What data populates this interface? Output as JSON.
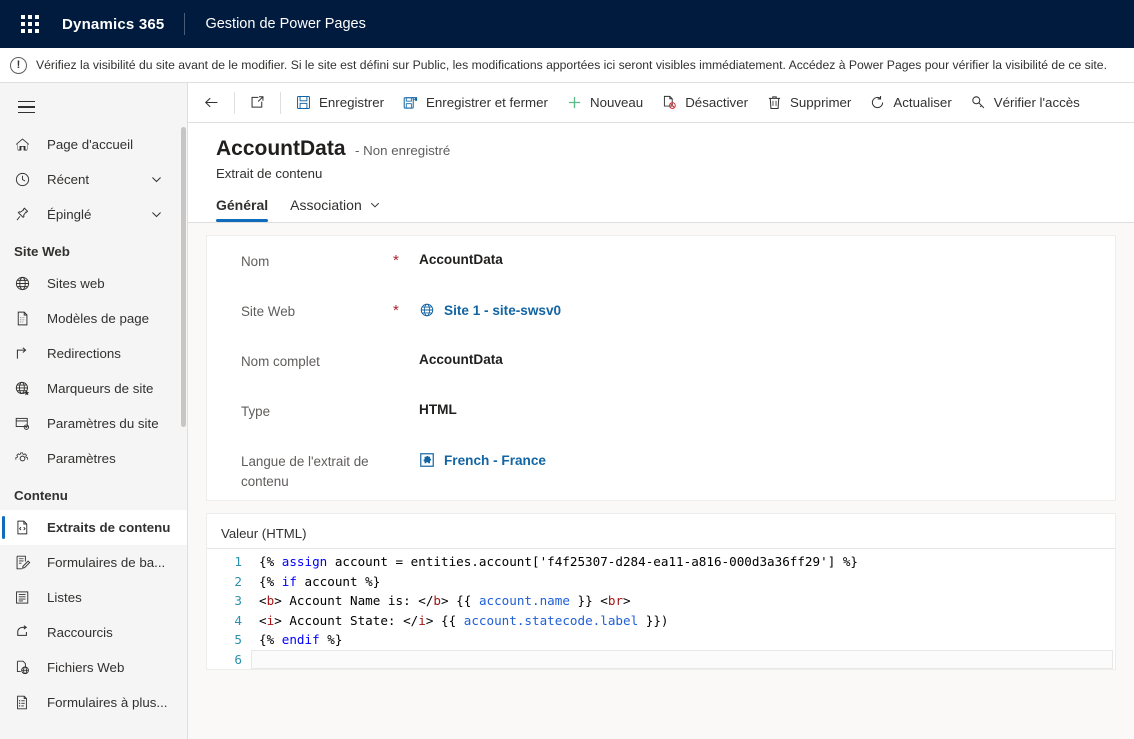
{
  "header": {
    "waffle_icon": "app-launcher-icon",
    "brand": "Dynamics 365",
    "app_name": "Gestion de Power Pages"
  },
  "notification": {
    "icon": "alert-exclamation-icon",
    "text": "Vérifiez la visibilité du site avant de le modifier. Si le site est défini sur Public, les modifications apportées ici seront visibles immédiatement. Accédez à Power Pages pour vérifier la visibilité de ce site."
  },
  "sidebar": {
    "menu_icon": "hamburger-menu-icon",
    "items": [
      {
        "label": "Page d'accueil",
        "icon": "home-icon",
        "expandable": false,
        "selected": false
      },
      {
        "label": "Récent",
        "icon": "clock-icon",
        "expandable": true,
        "selected": false
      },
      {
        "label": "Épinglé",
        "icon": "pin-icon",
        "expandable": true,
        "selected": false
      }
    ],
    "groups": [
      {
        "title": "Site Web",
        "items": [
          {
            "label": "Sites web",
            "icon": "globe-icon",
            "selected": false
          },
          {
            "label": "Modèles de page",
            "icon": "page-template-icon",
            "selected": false
          },
          {
            "label": "Redirections",
            "icon": "redirect-arrow-icon",
            "selected": false
          },
          {
            "label": "Marqueurs de site",
            "icon": "globe-star-icon",
            "selected": false
          },
          {
            "label": "Paramètres du site",
            "icon": "site-settings-icon",
            "selected": false
          },
          {
            "label": "Paramètres",
            "icon": "gear-icon",
            "selected": false
          }
        ]
      },
      {
        "title": "Contenu",
        "items": [
          {
            "label": "Extraits de contenu",
            "icon": "code-snippet-icon",
            "selected": true
          },
          {
            "label": "Formulaires de ba...",
            "icon": "form-edit-icon",
            "selected": false
          },
          {
            "label": "Listes",
            "icon": "list-icon",
            "selected": false
          },
          {
            "label": "Raccourcis",
            "icon": "shortcut-icon",
            "selected": false
          },
          {
            "label": "Fichiers Web",
            "icon": "web-file-icon",
            "selected": false
          },
          {
            "label": "Formulaires à plus...",
            "icon": "multistep-form-icon",
            "selected": false
          }
        ]
      }
    ]
  },
  "commandbar": {
    "back_icon": "back-arrow-icon",
    "popout_icon": "open-in-new-window-icon",
    "buttons": [
      {
        "label": "Enregistrer",
        "icon": "save-icon"
      },
      {
        "label": "Enregistrer et fermer",
        "icon": "save-and-close-icon"
      },
      {
        "label": "Nouveau",
        "icon": "plus-icon"
      },
      {
        "label": "Désactiver",
        "icon": "deactivate-icon"
      },
      {
        "label": "Supprimer",
        "icon": "trash-icon"
      },
      {
        "label": "Actualiser",
        "icon": "refresh-icon"
      },
      {
        "label": "Vérifier l'accès",
        "icon": "key-icon"
      }
    ]
  },
  "record": {
    "title": "AccountData",
    "state": "- Non enregistré",
    "entity": "Extrait de contenu",
    "tabs": [
      {
        "label": "Général",
        "active": true,
        "has_chevron": false
      },
      {
        "label": "Association",
        "active": false,
        "has_chevron": true
      }
    ]
  },
  "form": {
    "fields": [
      {
        "label": "Nom",
        "required": "*",
        "value": "AccountData",
        "type": "text"
      },
      {
        "label": "Site Web",
        "required": "*",
        "value": "Site 1 - site-swsv0",
        "type": "lookup",
        "icon": "globe-icon"
      },
      {
        "label": "Nom complet",
        "required": "",
        "value": "AccountData",
        "type": "text"
      },
      {
        "label": "Type",
        "required": "",
        "value": "HTML",
        "type": "text"
      },
      {
        "label": "Langue de l'extrait de contenu",
        "required": "",
        "value": "French - France",
        "type": "lookup",
        "icon": "language-puzzle-icon"
      }
    ]
  },
  "editor": {
    "label": "Valeur (HTML)",
    "lines": [
      {
        "number": "1",
        "text": "{% assign account = entities.account['f4f25307-d284-ea11-a816-000d3a36ff29'] %}"
      },
      {
        "number": "2",
        "text": "{% if account %}"
      },
      {
        "number": "3",
        "text": "<b> Account Name is: </b> {{ account.name }} <br>"
      },
      {
        "number": "4",
        "text": "<i> Account State: </i> {{ account.statecode.label }})"
      },
      {
        "number": "5",
        "text": "{% endif %}"
      },
      {
        "number": "6",
        "text": ""
      }
    ]
  },
  "colors": {
    "suite_header_bg": "#001b3d",
    "accent": "#0f6cbd",
    "link": "#1264a3",
    "required": "#a4262c",
    "sidebar_bg": "#f5f5f5",
    "canvas_bg": "#faf9f8"
  }
}
